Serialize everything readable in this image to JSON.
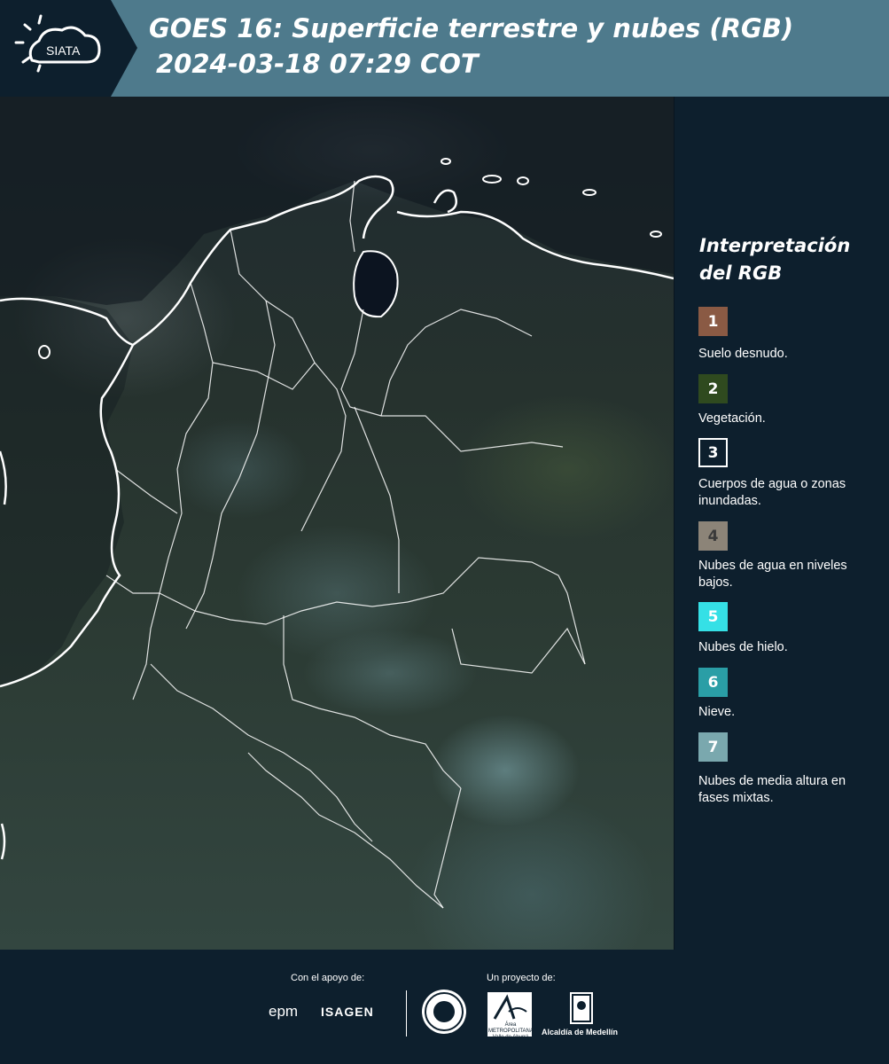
{
  "header": {
    "logo_text": "SIATA",
    "title": "GOES 16: Superficie terrestre y nubes (RGB)",
    "timestamp": "2024-03-18 07:29 COT"
  },
  "map": {
    "description_icon": "satellite-rgb-map",
    "colors": {
      "coastline": "#ffffff",
      "borders": "#ffffff",
      "water": "#0d1420"
    }
  },
  "legend": {
    "title": "Interpretación del RGB",
    "items": [
      {
        "number": "1",
        "label": "Suelo desnudo.",
        "color": "#8a5a44"
      },
      {
        "number": "2",
        "label": "Vegetación.",
        "color": "#2f4a1f"
      },
      {
        "number": "3",
        "label": "Cuerpos de agua o zonas inundadas.",
        "color": "#0d1f2d"
      },
      {
        "number": "4",
        "label": "Nubes de agua en niveles bajos.",
        "color": "#8c8478"
      },
      {
        "number": "5",
        "label": "Nubes de hielo.",
        "color": "#35e0e6"
      },
      {
        "number": "6",
        "label": "Nieve.",
        "color": "#2a9ea6"
      },
      {
        "number": "7",
        "label": "Nubes de media altura en fases mixtas.",
        "color": "#7aa8ae"
      }
    ]
  },
  "footer": {
    "support_label": "Con el apoyo de:",
    "project_label": "Un proyecto de:",
    "epm": "epm",
    "isagen": "ISAGEN",
    "area_text": "Área METROPOLITANA Valle de Aburrá",
    "alcaldia_text": "Alcaldía de Medellín"
  }
}
